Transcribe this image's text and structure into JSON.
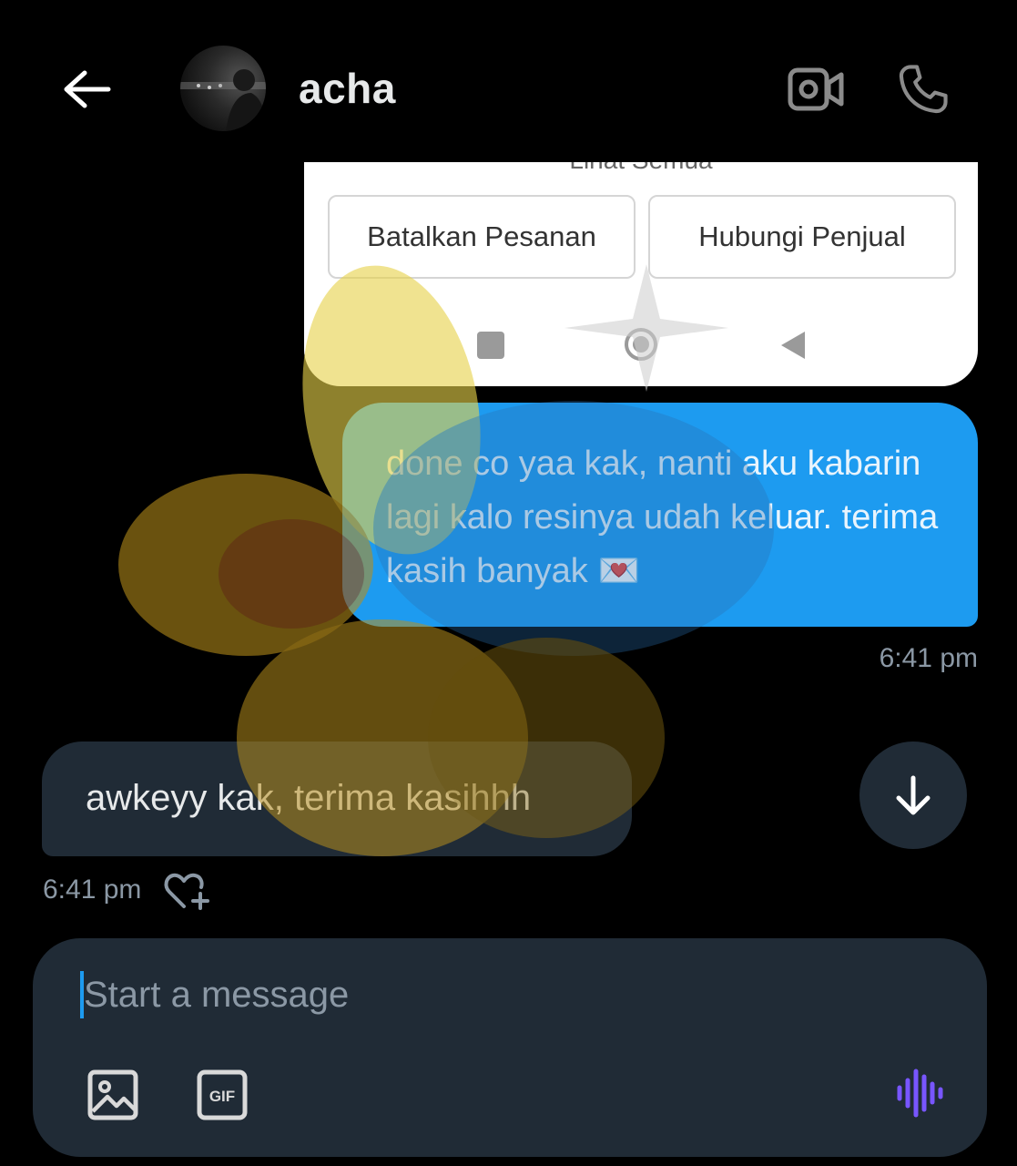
{
  "header": {
    "contact_name": "acha",
    "icons": {
      "back": "arrow-left-icon",
      "video": "video-camera-icon",
      "call": "phone-icon"
    }
  },
  "shared_card": {
    "top_text": "Lihat Semua",
    "buttons": [
      "Batalkan Pesanan",
      "Hubungi Penjual"
    ],
    "nav_icons": [
      "square-icon",
      "circle-home-icon",
      "triangle-back-icon"
    ]
  },
  "messages": [
    {
      "direction": "outgoing",
      "text": "done co yaa kak, nanti aku kabarin lagi kalo resinya udah keluar. terima kasih banyak 💌",
      "time": "6:41 pm"
    },
    {
      "direction": "incoming",
      "text": "awkeyy kak, terima kasihhh",
      "time": "6:41 pm"
    }
  ],
  "composer": {
    "placeholder": "Start a message",
    "value": "",
    "gif_label": "GIF",
    "icons": {
      "media": "image-icon",
      "gif": "gif-icon",
      "voice": "voice-wave-icon"
    }
  },
  "colors": {
    "background": "#000000",
    "accent": "#1d9bf0",
    "bubble_incoming": "#202b36",
    "voice_icon": "#7856ff"
  }
}
